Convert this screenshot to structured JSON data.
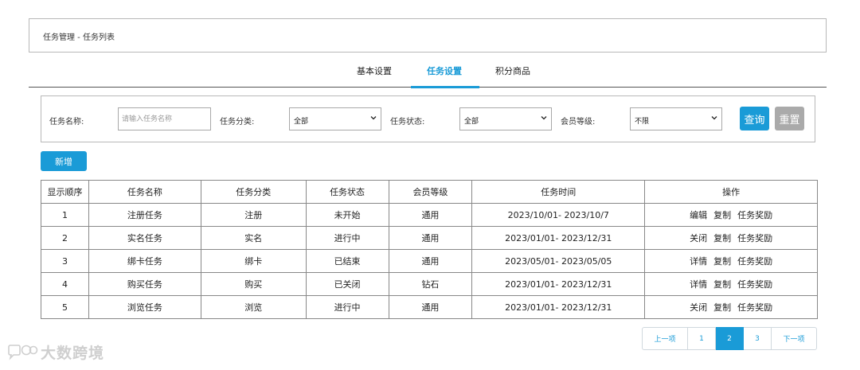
{
  "breadcrumb": "任务管理 - 任务列表",
  "tabs": [
    {
      "label": "基本设置"
    },
    {
      "label": "任务设置"
    },
    {
      "label": "积分商品"
    }
  ],
  "filters": {
    "name_label": "任务名称:",
    "name_placeholder": "请输入任务名称",
    "category_label": "任务分类:",
    "category_value": "全部",
    "status_label": "任务状态:",
    "status_value": "全部",
    "level_label": "会员等级:",
    "level_value": "不限",
    "query_label": "查询",
    "reset_label": "重置"
  },
  "add_label": "新增",
  "table": {
    "headers": [
      "显示顺序",
      "任务名称",
      "任务分类",
      "任务状态",
      "会员等级",
      "任务时间",
      "操作"
    ],
    "rows": [
      {
        "order": "1",
        "name": "注册任务",
        "category": "注册",
        "status": "未开始",
        "level": "通用",
        "time": "2023/10/01- 2023/10/7",
        "op1": "编辑",
        "op2": "复制",
        "op3": "任务奖励"
      },
      {
        "order": "2",
        "name": "实名任务",
        "category": "实名",
        "status": "进行中",
        "level": "通用",
        "time": "2023/01/01- 2023/12/31",
        "op1": "关闭",
        "op2": "复制",
        "op3": "任务奖励"
      },
      {
        "order": "3",
        "name": "绑卡任务",
        "category": "绑卡",
        "status": "已结束",
        "level": "通用",
        "time": "2023/05/01- 2023/05/05",
        "op1": "详情",
        "op2": "复制",
        "op3": "任务奖励"
      },
      {
        "order": "4",
        "name": "购买任务",
        "category": "购买",
        "status": "已关闭",
        "level": "钻石",
        "time": "2023/01/01- 2023/12/31",
        "op1": "详情",
        "op2": "复制",
        "op3": "任务奖励"
      },
      {
        "order": "5",
        "name": "浏览任务",
        "category": "浏览",
        "status": "进行中",
        "level": "通用",
        "time": "2023/01/01- 2023/12/31",
        "op1": "关闭",
        "op2": "复制",
        "op3": "任务奖励"
      }
    ]
  },
  "pagination": {
    "prev": "上一项",
    "pages": [
      "1",
      "2",
      "3"
    ],
    "next": "下一项"
  },
  "watermark": "大数跨境",
  "colors": {
    "accent": "#1a9bd7",
    "reset": "#aaaaaa"
  }
}
